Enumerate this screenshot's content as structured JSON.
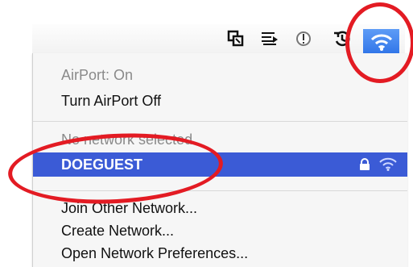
{
  "menubar": {
    "icons": [
      "window-icon",
      "timemachine-tray-icon",
      "alert-icon",
      "time-machine-icon",
      "wifi-icon"
    ]
  },
  "menu": {
    "status": "AirPort: On",
    "toggle": "Turn AirPort Off",
    "no_network": "No network selected",
    "network_name": "DOEGUEST",
    "network_icons": [
      "lock-icon",
      "wifi-signal-icon"
    ],
    "join_other": "Join Other Network...",
    "create": "Create Network...",
    "preferences": "Open Network Preferences..."
  },
  "colors": {
    "selected_row": "#3b5bd6",
    "wifi_highlight": "#4a8cf0",
    "annotation": "#e31b23"
  }
}
